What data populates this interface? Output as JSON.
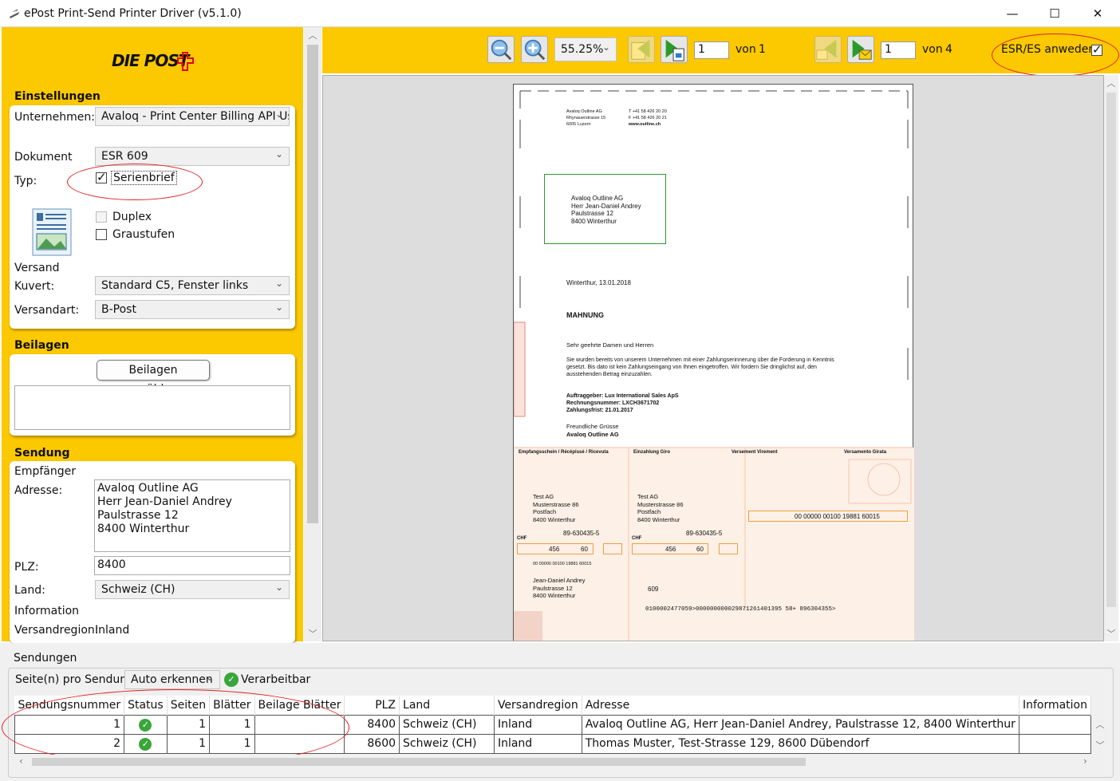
{
  "window": {
    "title": "ePost Print-Send Printer Driver (v5.1.0)",
    "minimize": "—",
    "maximize": "☐",
    "close": "✕"
  },
  "logo": {
    "text": "DIE POST"
  },
  "settings": {
    "section_title": "Einstellungen",
    "company_label": "Unternehmen:",
    "company_value": "Avaloq - Print Center Billing API Use",
    "document_label": "Dokument",
    "document_value": "ESR 609",
    "type_label": "Typ:",
    "serienbrief_label": "Serienbrief",
    "serienbrief_checked": true,
    "duplex_label": "Duplex",
    "duplex_checked": false,
    "graustufen_label": "Graustufen",
    "graustufen_checked": false,
    "versand_label": "Versand",
    "kuvert_label": "Kuvert:",
    "kuvert_value": "Standard C5, Fenster links",
    "versandart_label": "Versandart:",
    "versandart_value": "B-Post"
  },
  "beilagen": {
    "section_title": "Beilagen",
    "select_button": "Beilagen auswählen..."
  },
  "sendung": {
    "section_title": "Sendung",
    "empfaenger_label": "Empfänger",
    "address_label": "Adresse:",
    "address_lines": [
      "Avaloq Outline AG",
      "Herr Jean-Daniel Andrey",
      "Paulstrasse 12",
      "8400 Winterthur"
    ],
    "plz_label": "PLZ:",
    "plz_value": "8400",
    "land_label": "Land:",
    "land_value": "Schweiz (CH)",
    "info_label": "Information",
    "region_label": "Versandregion:",
    "region_value": "Inland"
  },
  "toolbar": {
    "zoom_value": "55.25%",
    "page_value": "1",
    "page_of": "von",
    "page_total": "1",
    "doc_value": "1",
    "doc_of": "von",
    "doc_total": "4",
    "esr_label": "ESR/ES anweden",
    "esr_checked": true
  },
  "letter": {
    "sender": [
      "Avaloq Outline AG",
      "Rhynauerstrasse 15",
      "6005 Luzern"
    ],
    "sender_contact": [
      "T +41 58 426 20 20",
      "F +41 58 426 20 21",
      "www.outline.ch"
    ],
    "recipient": [
      "Avaloq Outline AG",
      "Herr Jean-Daniel Andrey",
      "Paulstrasse 12",
      "8400 Winterthur"
    ],
    "date_line": "Winterthur, 13.01.2018",
    "subject": "MAHNUNG",
    "salutation": "Sehr geehrte Damen und Herren",
    "body": [
      "Sie wurden bereits von unserem Unternehmen mit einer Zahlungserinnerung über die Forderung in Kenntnis",
      "gesetzt. Bis dato ist kein Zahlungseingang von Ihnen eingetroffen. Wir fordern Sie dringlichst auf, den",
      "ausstehenden Betrag einzuzahlen."
    ],
    "details": [
      "Auftraggeber: Lux International Sales ApS",
      "Rechnungsnummer: LXCH3671702",
      "Zahlungsfrist: 21.01.2017"
    ],
    "closing": "Freundliche Grüsse",
    "closing_company": "Avaloq Outline AG"
  },
  "slip": {
    "header_receipt": "Empfangsschein / Récépissé / Ricevuta",
    "header_payment": "Einzahlung Giro",
    "header_virement": "Versement Virement",
    "header_girata": "Versamento Girata",
    "beneficiary": [
      "Test AG",
      "Musterstrasse 86",
      "Postfach",
      "8400 Winterthur"
    ],
    "account": "89-630435-5",
    "currency": "CHF",
    "amount_francs": "456",
    "amount_cents": "60",
    "reference": "00 00000 00100 19881 60015",
    "reference_small": "00 00000 00100 19881 60015",
    "payer": [
      "Jean-Daniel Andrey",
      "Paulstrasse 12",
      "8400 Winterthur"
    ],
    "esr_type": "609",
    "coding_line": "0100002477059>000000000029871261401395 58+ 896304355>"
  },
  "sendungen": {
    "section_title": "Sendungen",
    "pages_label": "Seite(n) pro Sendung:",
    "pages_value": "Auto erkennen",
    "processable_label": "Verarbeitbar",
    "columns": [
      "Sendungsnummer",
      "Status",
      "Seiten",
      "Blätter",
      "Beilage Blätter",
      "PLZ",
      "Land",
      "Versandregion",
      "Adresse",
      "Information"
    ],
    "rows": [
      {
        "nr": "1",
        "seiten": "1",
        "blaetter": "1",
        "beilage": "",
        "plz": "8400",
        "land": "Schweiz (CH)",
        "region": "Inland",
        "adresse": "Avaloq Outline AG, Herr Jean-Daniel Andrey, Paulstrasse 12, 8400 Winterthur",
        "info": ""
      },
      {
        "nr": "2",
        "seiten": "1",
        "blaetter": "1",
        "beilage": "",
        "plz": "8600",
        "land": "Schweiz (CH)",
        "region": "Inland",
        "adresse": "Thomas Muster, Test-Strasse 129, 8600 Dübendorf",
        "info": ""
      }
    ]
  },
  "colors": {
    "brand_yellow": "#fcc800",
    "annotation_red": "#e02020",
    "status_green": "#3aa53a"
  }
}
